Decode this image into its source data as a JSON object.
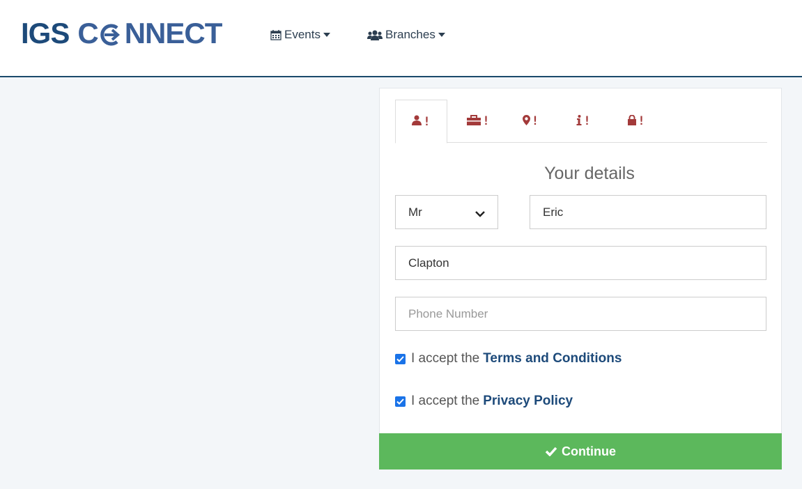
{
  "brand": {
    "prefix": "IGS",
    "word_a": "C",
    "word_b": "NNECT"
  },
  "nav": {
    "events": {
      "label": "Events",
      "icon": "calendar-icon"
    },
    "branches": {
      "label": "Branches",
      "icon": "users-icon"
    }
  },
  "tabs": [
    {
      "icon": "user-icon",
      "mark": "!",
      "active": true
    },
    {
      "icon": "briefcase-icon",
      "mark": "!",
      "active": false
    },
    {
      "icon": "map-marker-icon",
      "mark": "!",
      "active": false
    },
    {
      "icon": "info-icon",
      "mark": "!",
      "active": false
    },
    {
      "icon": "lock-icon",
      "mark": "!",
      "active": false
    }
  ],
  "form": {
    "title": "Your details",
    "title_select": {
      "value": "Mr"
    },
    "first_name": {
      "value": "Eric"
    },
    "last_name": {
      "value": "Clapton"
    },
    "phone": {
      "value": "",
      "placeholder": "Phone Number"
    },
    "terms": {
      "prefix": "I accept the",
      "link": "Terms and Conditions",
      "checked": true
    },
    "privacy": {
      "prefix": "I accept the",
      "link": "Privacy Policy",
      "checked": true
    },
    "continue_label": "Continue"
  },
  "colors": {
    "brand_dark": "#1d4a7a",
    "tab_icon": "#a33a3a",
    "continue_bg": "#5cb85c",
    "checkbox": "#1a73e8"
  }
}
